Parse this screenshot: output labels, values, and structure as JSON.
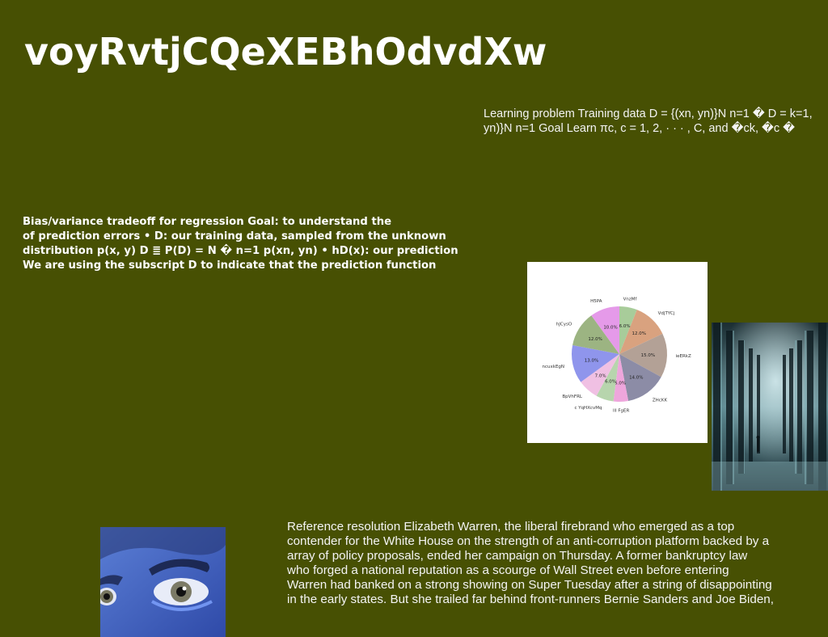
{
  "doc": {
    "title": "voyRvtjCQeXEBhOdvdXw",
    "learning_text": "Learning problem Training data D = {(xn, yn)}N n=1 � D = k=1, yn)}N n=1 Goal Learn πc, c = 1, 2, · · · , C, and �ck, �c �",
    "bias_text": "Bias/variance tradeoff for regression Goal: to understand the\nof prediction errors • D: our training data, sampled from the unknown\ndistribution p(x, y) D ≣ P(D) = N � n=1 p(xn, yn) • hD(x): our prediction\nWe are using the subscript D to indicate that the prediction function",
    "warren_text": "Reference resolution Elizabeth Warren, the liberal firebrand who emerged as a top\ncontender for the White House on the strength of an anti-corruption platform backed by a\narray of policy proposals, ended her campaign on Thursday. A former bankruptcy law\nwho forged a national reputation as a scourge of Wall Street even before entering\nWarren had banked on a strong showing on Super Tuesday after a string of disappointing\nin the early states. But she trailed far behind front-runners Bernie Sanders and Joe Biden,"
  },
  "chart_data": {
    "type": "pie",
    "categories": [
      "VnzMf",
      "VdjTYCj",
      "ieERkZ",
      "ZHcKK",
      "lll FgER",
      "c YqHXcvMq",
      "BpVhFRL",
      "ncuxkEgN",
      "hJCysO",
      "H5PA"
    ],
    "values": [
      6.0,
      12.0,
      15.0,
      14.0,
      5.0,
      6.0,
      7.0,
      13.0,
      12.0,
      10.0
    ],
    "value_labels": [
      "6.0%",
      "12.0%",
      "15.0%",
      "14.0%",
      "5.0%",
      "6.0%",
      "7.0%",
      "13.0%",
      "12.0%",
      "10.0%"
    ],
    "colors": [
      "#a8cc9a",
      "#d9a27f",
      "#b3a196",
      "#8c8ca6",
      "#eea6dc",
      "#b7d5ad",
      "#f0c0e3",
      "#8f95ec",
      "#9cb482",
      "#e59ae9"
    ],
    "start_angle_deg": 90,
    "direction": "clockwise"
  }
}
